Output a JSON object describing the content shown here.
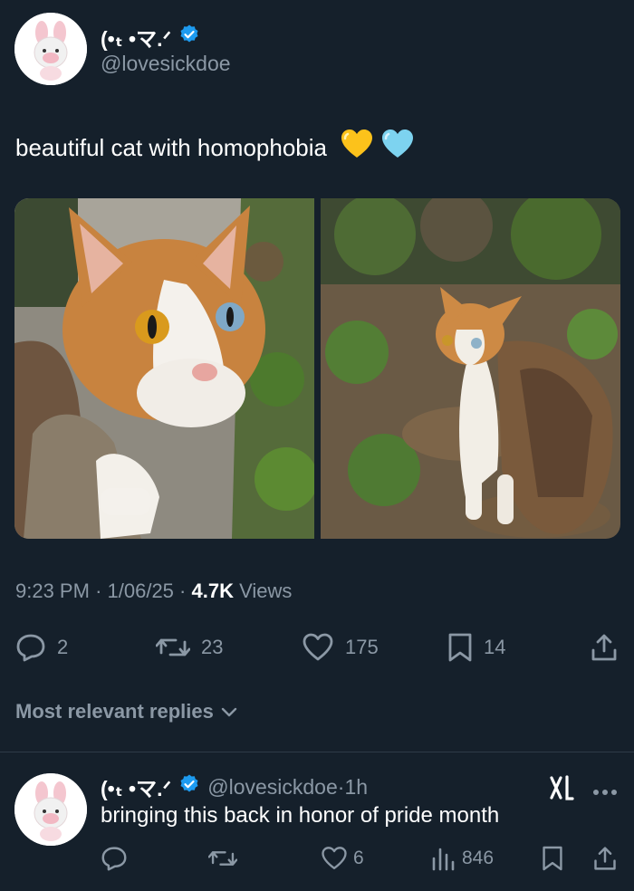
{
  "colors": {
    "background": "#15202b",
    "text_primary": "#ffffff",
    "text_secondary": "#8b98a5",
    "verified_blue": "#1d9bf0",
    "divider": "#2f3b47"
  },
  "tweet": {
    "author": {
      "display_name": "(•ₜ •マ.ᐟ",
      "handle": "@lovesickdoe",
      "verified": true,
      "avatar_icon": "pink-bunny-plush-avatar"
    },
    "text": "beautiful cat with homophobia",
    "emojis": [
      "yellow-heart-icon",
      "light-blue-heart-icon"
    ],
    "images": [
      {
        "icon": "calico-cat-closeup-photo"
      },
      {
        "icon": "calico-cat-in-leaves-photo"
      }
    ],
    "time": "9:23 PM",
    "date": "1/06/25",
    "views_count": "4.7K",
    "views_label": "Views",
    "replies": "2",
    "reposts": "23",
    "likes": "175",
    "bookmarks": "14"
  },
  "replies_sort": {
    "label": "Most relevant replies"
  },
  "reply": {
    "author": {
      "display_name": "(•ₜ •マ.ᐟ",
      "handle": "@lovesickdoe",
      "verified": true,
      "age": "1h"
    },
    "text": "bringing this back in honor of pride month",
    "likes": "6",
    "views": "846"
  }
}
